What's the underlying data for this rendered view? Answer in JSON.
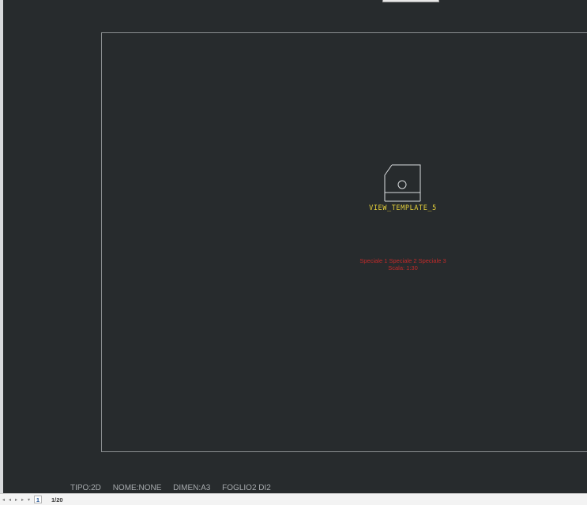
{
  "top_tag": {
    "label": ""
  },
  "drawing": {
    "view_label": "VIEW_TEMPLATE_5",
    "annotation_line1": "Speciale 1 Speciale 2 Speciale 3",
    "annotation_line2": "Scala: 1:30"
  },
  "status": {
    "tipo": "TIPO:2D",
    "nome": "NOME:NONE",
    "dimen": "DIMEN:A3",
    "foglio": "FOGLIO2  DI2"
  },
  "bottom_bar": {
    "page_current": "1",
    "page_count": "1/20"
  },
  "colors": {
    "background": "#272b2d",
    "frame": "#8c9092",
    "view_label": "#e8d33a",
    "annotation": "#c42a2a"
  },
  "icons": [
    "first-page-icon",
    "prev-page-icon",
    "next-page-icon",
    "last-page-icon",
    "page-menu-icon"
  ]
}
